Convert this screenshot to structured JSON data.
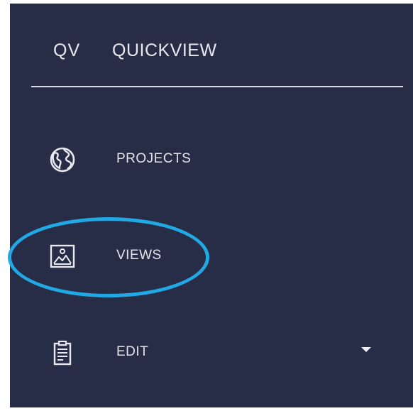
{
  "brand": {
    "short": "QV",
    "name": "QUICKVIEW"
  },
  "nav": {
    "items": [
      {
        "label": "PROJECTS",
        "icon": "globe-icon"
      },
      {
        "label": "VIEWS",
        "icon": "image-icon",
        "highlighted": true
      },
      {
        "label": "EDIT",
        "icon": "clipboard-icon",
        "has_dropdown": true
      }
    ]
  },
  "colors": {
    "sidebar_bg": "#282d47",
    "text": "#e8e9ee",
    "highlight_ring": "#21a9e6"
  }
}
